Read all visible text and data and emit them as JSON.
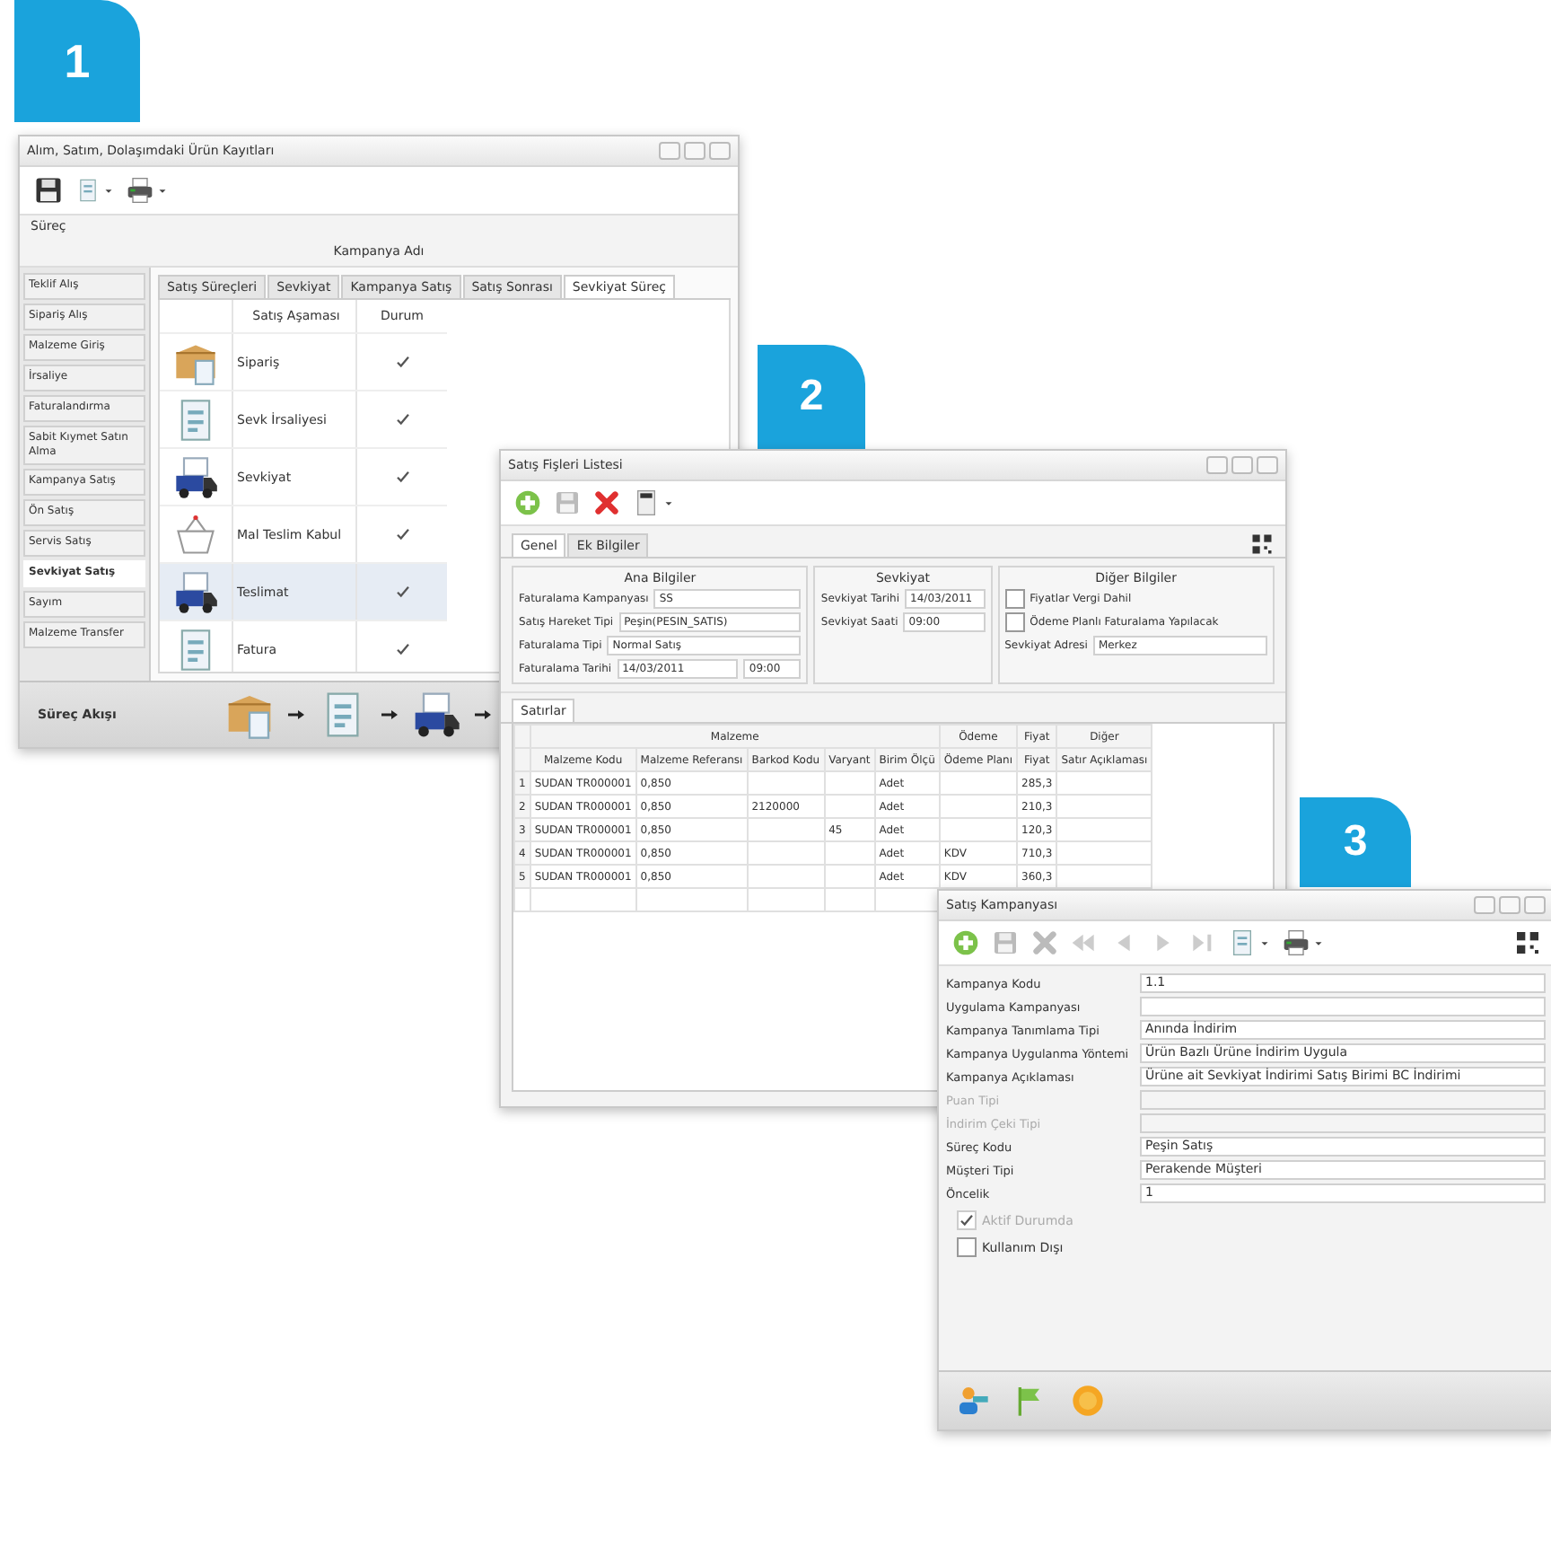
{
  "windows": [
    {
      "kind": "process",
      "step": "1",
      "title": "Alım, Satım, Dolaşımdaki Ürün Kayıtları",
      "section_label": "Süreç",
      "header_value": "Kampanya Adı",
      "sidebar": [
        {
          "label": "Teklif Alış",
          "selected": false
        },
        {
          "label": "Sipariş Alış",
          "selected": false
        },
        {
          "label": "Malzeme Giriş",
          "selected": false
        },
        {
          "label": "İrsaliye",
          "selected": false
        },
        {
          "label": "Faturalandırma",
          "selected": false
        },
        {
          "label": "Sabit Kıymet Satın Alma",
          "selected": false
        },
        {
          "label": "Kampanya Satış",
          "selected": false
        },
        {
          "label": "Ön Satış",
          "selected": false
        },
        {
          "label": "Servis Satış",
          "selected": false
        },
        {
          "label": "Sevkiyat Satış",
          "selected": true
        },
        {
          "label": "Sayım",
          "selected": false
        },
        {
          "label": "Malzeme Transfer",
          "selected": false
        }
      ],
      "tabs": [
        {
          "label": "Satış Süreçleri",
          "selected": false
        },
        {
          "label": "Sevkiyat",
          "selected": false
        },
        {
          "label": "Kampanya Satış",
          "selected": false
        },
        {
          "label": "Satış Sonrası",
          "selected": false
        },
        {
          "label": "Sevkiyat Süreç",
          "selected": true
        }
      ],
      "columns": [
        "Satış Aşaması",
        "Durum"
      ],
      "rows": [
        {
          "kind": "box",
          "label": "Sipariş",
          "checked": true,
          "selected": false
        },
        {
          "kind": "document",
          "label": "Sevk İrsaliyesi",
          "checked": true,
          "selected": false
        },
        {
          "kind": "truck",
          "label": "Sevkiyat",
          "checked": true,
          "selected": false
        },
        {
          "kind": "basket",
          "label": "Mal Teslim Kabul",
          "checked": true,
          "selected": false
        },
        {
          "kind": "truck",
          "label": "Teslimat",
          "checked": true,
          "selected": true
        },
        {
          "kind": "document",
          "label": "Fatura",
          "checked": true,
          "selected": false
        }
      ],
      "footer_title": "Süreç Akışı",
      "flow": [
        {
          "kind": "box"
        },
        {
          "kind": "document"
        },
        {
          "kind": "truck"
        }
      ]
    },
    {
      "kind": "invoice",
      "step": "2",
      "title": "Satış Fişleri Listesi",
      "tabs": [
        {
          "label": "Genel",
          "selected": true
        },
        {
          "label": "Ek Bilgiler",
          "selected": false
        }
      ],
      "groups": [
        {
          "title": "Ana Bilgiler",
          "fields": [
            {
              "label": "Faturalama Kampanyası",
              "value": "SS"
            },
            {
              "label": "Satış Hareket Tipi",
              "value": "Peşin(PESIN_SATIS)"
            },
            {
              "label": "Faturalama Tipi",
              "value": "Normal Satış"
            },
            {
              "label": "Faturalama Tarihi",
              "value": "14/03/2011",
              "time": "09:00"
            }
          ]
        },
        {
          "title": "Sevkiyat",
          "fields": [
            {
              "label": "Sevkiyat Tarihi",
              "value": "14/03/2011"
            },
            {
              "label": "Sevkiyat Saati",
              "value": "09:00"
            }
          ]
        },
        {
          "title": "Diğer Bilgiler",
          "checks": [
            {
              "label": "Fiyatlar Vergi Dahil",
              "checked": false
            },
            {
              "label": "Ödeme Planlı Faturalama Yapılacak",
              "checked": false
            }
          ],
          "fields": [
            {
              "label": "Sevkiyat Adresi",
              "value": "Merkez"
            }
          ]
        }
      ],
      "lines_tab": "Satırlar",
      "column_groups": [
        "Malzeme",
        "Ödeme",
        "Fiyat",
        "Diğer"
      ],
      "columns": [
        "Malzeme Kodu",
        "Malzeme Referansı",
        "Barkod Kodu",
        "Varyant",
        "Birim Ölçü",
        "Ödeme Planı",
        "Fiyat",
        "Satır Açıklaması"
      ],
      "rows": [
        {
          "number": "1",
          "cells": [
            "SUDAN TR000001",
            "0,850",
            "",
            "",
            "Adet",
            "",
            "285,3",
            ""
          ]
        },
        {
          "number": "2",
          "cells": [
            "SUDAN TR000001",
            "0,850",
            "2120000",
            "",
            "Adet",
            "",
            "210,3",
            ""
          ]
        },
        {
          "number": "3",
          "cells": [
            "SUDAN TR000001",
            "0,850",
            "",
            "45",
            "Adet",
            "",
            "120,3",
            ""
          ]
        },
        {
          "number": "4",
          "cells": [
            "SUDAN TR000001",
            "0,850",
            "",
            "",
            "Adet",
            "KDV",
            "710,3",
            ""
          ]
        },
        {
          "number": "5",
          "cells": [
            "SUDAN TR000001",
            "0,850",
            "",
            "",
            "Adet",
            "KDV",
            "360,3",
            ""
          ]
        }
      ]
    },
    {
      "kind": "campaign",
      "step": "3",
      "title": "Satış Kampanyası",
      "fields": [
        {
          "label": "Kampanya Kodu",
          "value": "1.1",
          "disabled": false
        },
        {
          "label": "Uygulama Kampanyası",
          "disabled": false
        },
        {
          "label": "Kampanya Tanımlama Tipi",
          "value": "Anında İndirim",
          "disabled": false
        },
        {
          "label": "Kampanya Uygulanma Yöntemi",
          "value": "Ürün Bazlı Ürüne İndirim Uygula",
          "disabled": false
        },
        {
          "label": "Kampanya Açıklaması",
          "value": "Ürüne ait Sevkiyat İndirimi Satış Birimi BC İndirimi",
          "disabled": false
        },
        {
          "label": "Puan Tipi",
          "disabled": true
        },
        {
          "label": "İndirim Çeki Tipi",
          "disabled": true
        },
        {
          "label": "Süreç Kodu",
          "value": "Peşin Satış",
          "disabled": false
        },
        {
          "label": "Müşteri Tipi",
          "value": "Perakende Müşteri",
          "disabled": false
        },
        {
          "label": "Öncelik",
          "value": "1",
          "disabled": false
        }
      ],
      "checks": [
        {
          "label": "Aktif Durumda",
          "checked": true,
          "disabled": true
        },
        {
          "label": "Kullanım Dışı",
          "checked": false,
          "disabled": false
        }
      ]
    }
  ]
}
